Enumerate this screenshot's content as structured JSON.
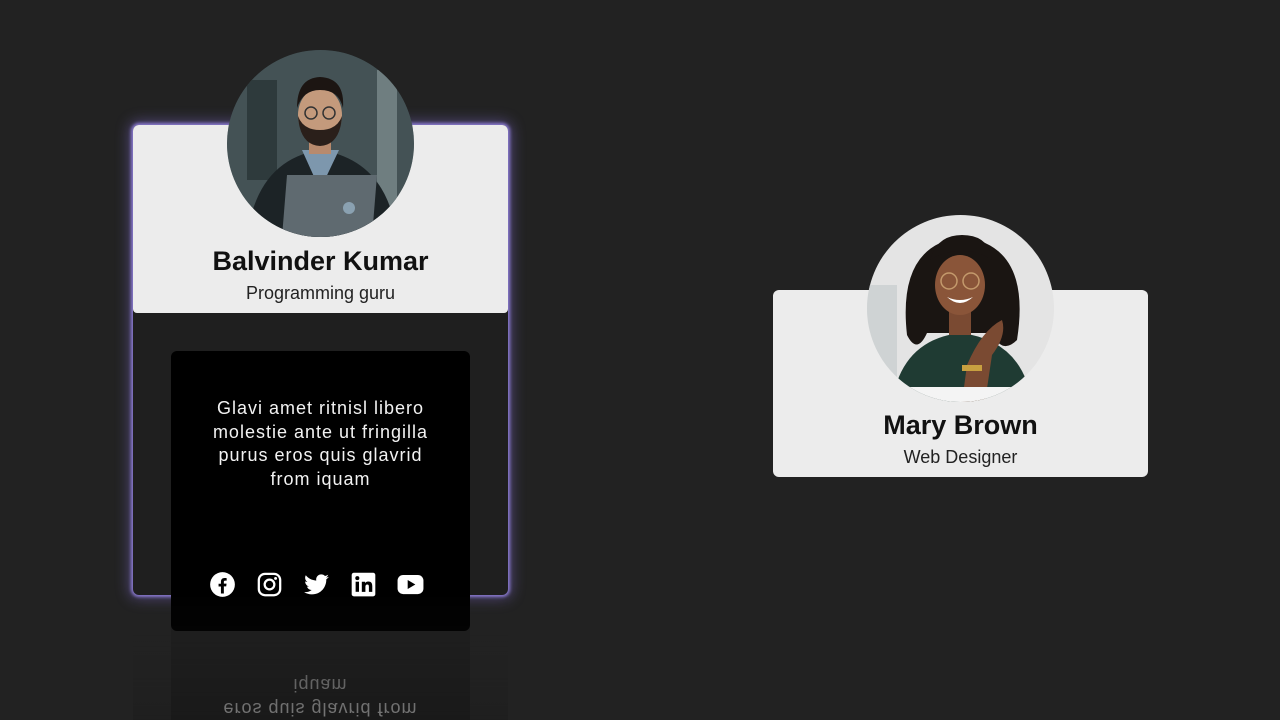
{
  "cards": [
    {
      "name": "Balvinder Kumar",
      "role": "Programming guru",
      "bio": "Glavi amet ritnisl libero molestie ante ut fringilla purus eros quis glavrid from iquam",
      "bio_reflection": "eros quis glavrid from iquam",
      "socials": [
        "facebook-icon",
        "instagram-icon",
        "twitter-icon",
        "linkedin-icon",
        "youtube-icon"
      ]
    },
    {
      "name": "Mary Brown",
      "role": "Web Designer"
    }
  ],
  "colors": {
    "background": "#222222",
    "card": "#ececec",
    "panel": "#000000",
    "glow": "#8a7ad0"
  }
}
